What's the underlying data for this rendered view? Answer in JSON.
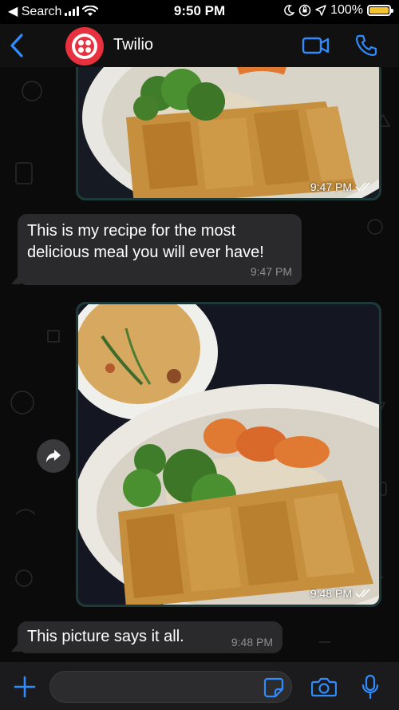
{
  "status_bar": {
    "back_label": "◀ Search",
    "time": "9:50 PM",
    "battery": "100%",
    "battery_level": 1.0
  },
  "header": {
    "contact_name": "Twilio",
    "accent_color": "#2f8cff",
    "avatar_color": "#e8303e"
  },
  "messages": [
    {
      "type": "image",
      "direction": "incoming",
      "time": "9:47 PM",
      "status_icon": "double-check-icon"
    },
    {
      "type": "text",
      "direction": "incoming",
      "text_line1": "This is my recipe for the most",
      "text_line2": "delicious meal you will ever have!",
      "time": "9:47 PM"
    },
    {
      "type": "image",
      "direction": "incoming",
      "time": "9:48 PM",
      "status_icon": "double-check-icon"
    },
    {
      "type": "text",
      "direction": "incoming",
      "text": "This picture says it all.",
      "time": "9:48 PM"
    }
  ],
  "composer": {
    "placeholder": ""
  }
}
